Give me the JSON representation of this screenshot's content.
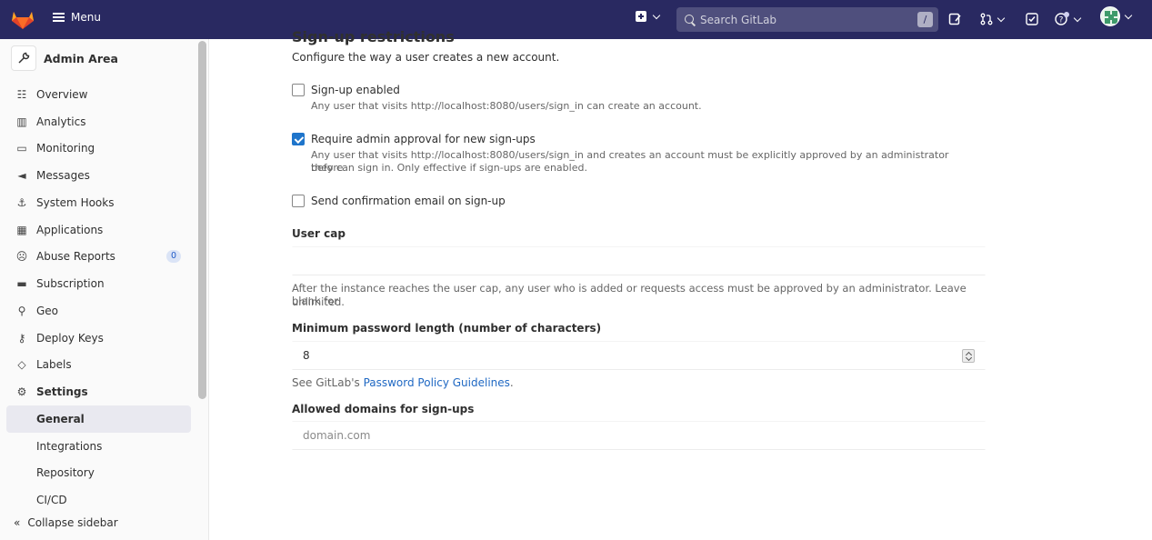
{
  "navbar": {
    "menu_label": "Menu",
    "search_placeholder": "Search GitLab",
    "search_shortcut": "/"
  },
  "sidebar": {
    "title": "Admin Area",
    "items": [
      {
        "label": "Overview",
        "icon": "overview-icon"
      },
      {
        "label": "Analytics",
        "icon": "chart-icon"
      },
      {
        "label": "Monitoring",
        "icon": "monitor-icon"
      },
      {
        "label": "Messages",
        "icon": "bullhorn-icon"
      },
      {
        "label": "System Hooks",
        "icon": "anchor-icon"
      },
      {
        "label": "Applications",
        "icon": "grid-icon"
      },
      {
        "label": "Abuse Reports",
        "icon": "sad-face-icon",
        "badge": "0"
      },
      {
        "label": "Subscription",
        "icon": "credit-card-icon"
      },
      {
        "label": "Geo",
        "icon": "location-icon"
      },
      {
        "label": "Deploy Keys",
        "icon": "key-icon"
      },
      {
        "label": "Labels",
        "icon": "label-icon"
      },
      {
        "label": "Settings",
        "icon": "gear-icon"
      }
    ],
    "sub_items": [
      "General",
      "Integrations",
      "Repository",
      "CI/CD"
    ],
    "collapse_label": "Collapse sidebar"
  },
  "main": {
    "heading": "Sign-up restrictions",
    "description": "Configure the way a user creates a new account.",
    "signup_enabled": {
      "label": "Sign-up enabled",
      "checked": false,
      "help": "Any user that visits http://localhost:8080/users/sign_in can create an account."
    },
    "require_approval": {
      "label": "Require admin approval for new sign-ups",
      "checked": true,
      "help_line1": "Any user that visits http://localhost:8080/users/sign_in and creates an account must be explicitly approved by an administrator before",
      "help_line2": "they can sign in. Only effective if sign-ups are enabled."
    },
    "confirmation_email": {
      "label": "Send confirmation email on sign-up",
      "checked": false
    },
    "user_cap": {
      "label": "User cap",
      "value": "",
      "help_line1": "After the instance reaches the user cap, any user who is added or requests access must be approved by an administrator. Leave blank for",
      "help_line2": "unlimited."
    },
    "min_password": {
      "label": "Minimum password length (number of characters)",
      "value": "8",
      "help_prefix": "See GitLab's ",
      "help_link": "Password Policy Guidelines",
      "help_suffix": "."
    },
    "allowed_domains": {
      "label": "Allowed domains for sign-ups",
      "placeholder": "domain.com"
    }
  }
}
